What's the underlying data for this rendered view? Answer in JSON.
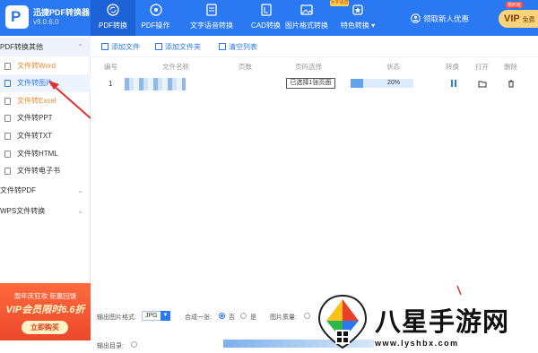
{
  "app": {
    "name": "迅捷PDF转换器",
    "version": "v9.0.6.0"
  },
  "nav": [
    {
      "label": "PDF转换",
      "icon": "refresh-icon"
    },
    {
      "label": "PDF操作",
      "icon": "compass-icon"
    },
    {
      "label": "文字语音转换",
      "icon": "text-doc-icon"
    },
    {
      "label": "CAD转换",
      "icon": "cad-icon"
    },
    {
      "label": "图片格式转换",
      "icon": "image-icon"
    },
    {
      "label": "特色转换",
      "icon": "star-icon"
    }
  ],
  "nav_hot_badge": "大字语音",
  "promo": {
    "label": "领取新人优惠",
    "vip": "VIP",
    "vip_suffix": "免费",
    "tag": "限时抢"
  },
  "sidebar": {
    "sections": [
      {
        "label": "PDF转换其他",
        "chevron": "⌃"
      },
      {
        "label": "文件转PDF",
        "chevron": "⌄"
      },
      {
        "label": "WPS文件转换",
        "chevron": "⌄"
      }
    ],
    "items": [
      {
        "label": "文件转Word"
      },
      {
        "label": "文件转图片"
      },
      {
        "label": "文件转Excel"
      },
      {
        "label": "文件转PPT"
      },
      {
        "label": "文件转TXT"
      },
      {
        "label": "文件转HTML"
      },
      {
        "label": "文件转电子书"
      }
    ]
  },
  "banner": {
    "line1": "周年庆狂欢 钜惠回馈",
    "line2": "VIP会员限时6.6折",
    "button": "立即购买"
  },
  "toolbar": {
    "add_file": "添加文件",
    "add_folder": "添加文件夹",
    "clear": "清空列表"
  },
  "table": {
    "headers": [
      "编号",
      "文件名称",
      "页数",
      "页码选择",
      "状态",
      "转换",
      "打开",
      "删除"
    ],
    "rows": [
      {
        "no": "1",
        "pages_button": "已选择1张页面",
        "progress": 0.2,
        "progress_text": "20%"
      }
    ]
  },
  "bottom": {
    "format_label": "输出图片格式:",
    "format_value": "JPG",
    "merge_label": "合成一张:",
    "merge_yes": "否",
    "merge_no": "是",
    "quality_label": "图片质量:",
    "out_dir_label": "输出目录:"
  },
  "watermark": {
    "big": "八星手游网",
    "url": "www.lyshbx.com"
  },
  "colors": {
    "accent": "#2a78f2",
    "orange": "#e88b2c",
    "banner": "#e8402a"
  }
}
